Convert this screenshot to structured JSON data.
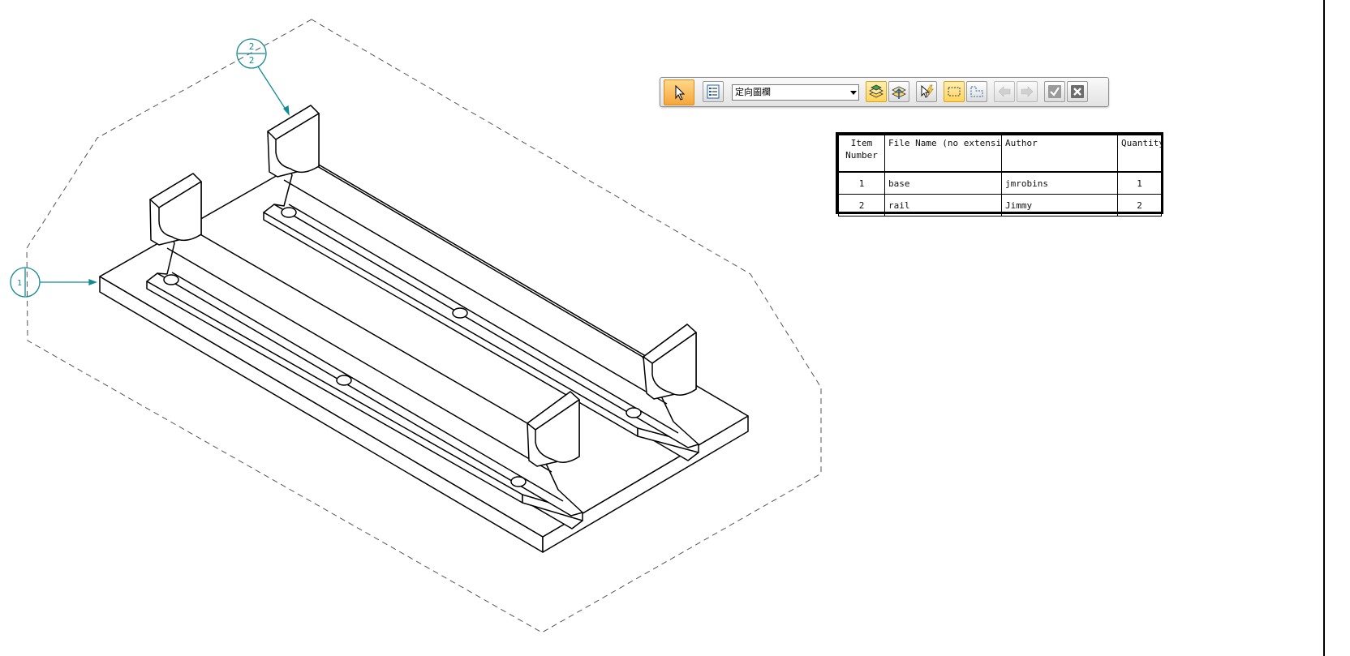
{
  "command_bar": {
    "orientation_select": {
      "value": "定向圖欄"
    },
    "buttons": [
      {
        "name": "select-tool",
        "icon": "pointer-arrow-icon"
      },
      {
        "name": "properties",
        "icon": "properties-list-icon"
      },
      {
        "name": "item-number-1",
        "icon": "stacked-layers-icon"
      },
      {
        "name": "item-number-2",
        "icon": "layers-move-icon"
      },
      {
        "name": "auto-balloon",
        "icon": "pointer-lightning-icon"
      },
      {
        "name": "balloon-region",
        "icon": "rectangle-region-icon"
      },
      {
        "name": "balloon-region-2",
        "icon": "corner-region-icon"
      },
      {
        "name": "previous",
        "icon": "arrow-left-icon"
      },
      {
        "name": "next",
        "icon": "arrow-right-icon"
      },
      {
        "name": "accept",
        "icon": "check-icon"
      },
      {
        "name": "cancel",
        "icon": "close-icon"
      }
    ]
  },
  "parts_list": {
    "columns": [
      "Item Number",
      "File Name (no extension)",
      "Author",
      "Quantity"
    ],
    "rows": [
      {
        "item": "1",
        "file_name": "base",
        "author": "jmrobins",
        "quantity": "1"
      },
      {
        "item": "2",
        "file_name": "rail",
        "author": "Jimmy",
        "quantity": "2"
      }
    ]
  },
  "balloons": [
    {
      "item": "2",
      "quantity": "2"
    },
    {
      "item": "1"
    }
  ],
  "colors": {
    "balloon": "#138a94",
    "geometry": "#000000",
    "dashed_boundary": "#555555",
    "active_button": "#f5a63a",
    "highlight_button": "#ffd45c"
  }
}
